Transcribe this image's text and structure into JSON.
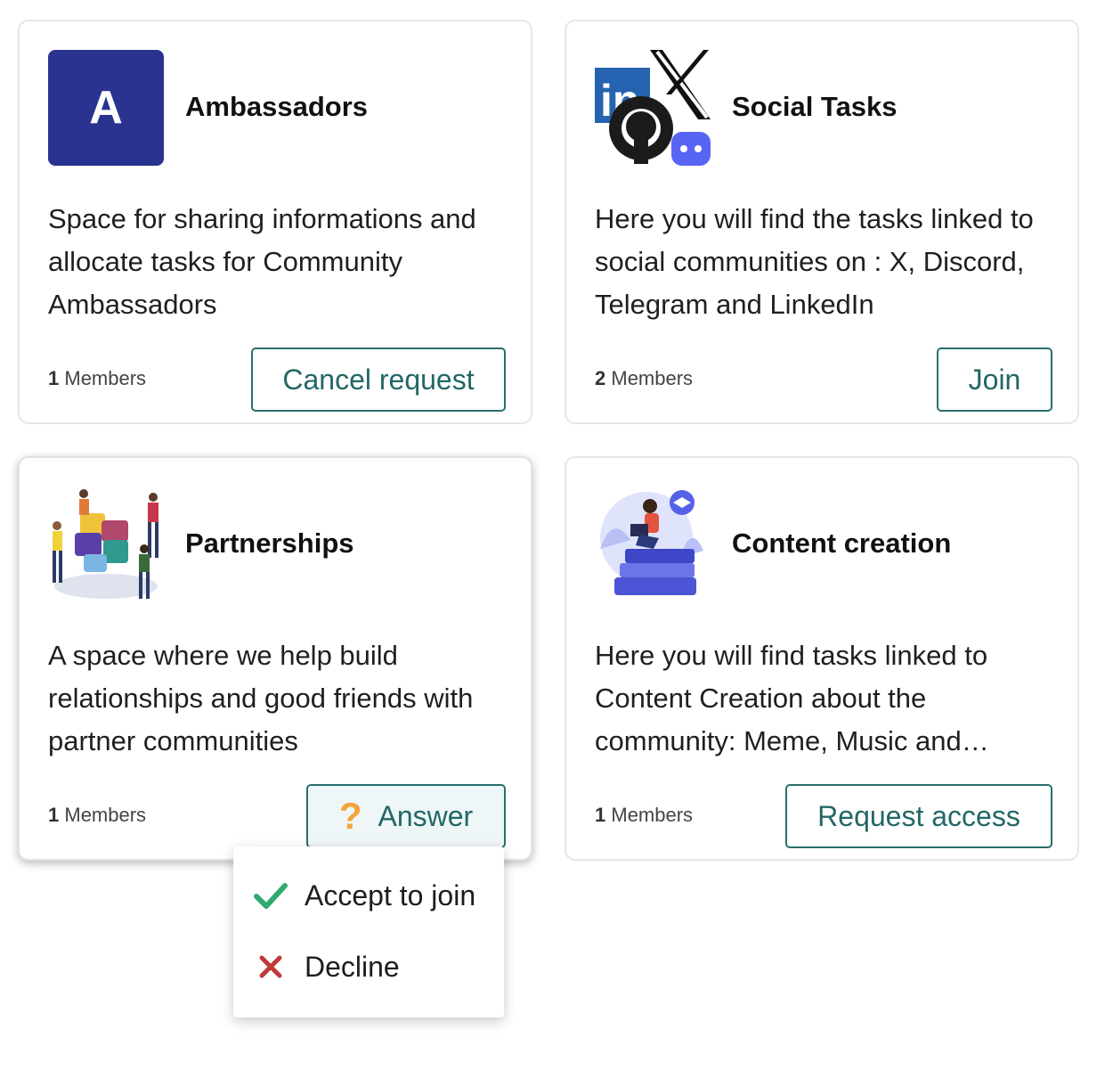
{
  "cards": [
    {
      "title": "Ambassadors",
      "avatar_letter": "A",
      "description": "Space for sharing informations and allocate tasks for Community Ambassadors",
      "members_count": "1",
      "members_label": "Members",
      "button_label": "Cancel request",
      "accent": "#2a3490"
    },
    {
      "title": "Social Tasks",
      "icon_name": "social-logos-icon",
      "description": "Here you will find the tasks linked to social communities on : X, Discord, Telegram and LinkedIn",
      "members_count": "2",
      "members_label": "Members",
      "button_label": "Join"
    },
    {
      "title": "Partnerships",
      "icon_name": "puzzle-people-illustration",
      "description": "A space where we help build relationships and good friends with partner communities",
      "members_count": "1",
      "members_label": "Members",
      "button_label": "Answer",
      "button_icon": "question-icon"
    },
    {
      "title": "Content creation",
      "icon_name": "reading-person-illustration",
      "description": "Here you will find tasks linked to Content Creation about the community: Meme, Music and…",
      "members_count": "1",
      "members_label": "Members",
      "button_label": "Request access"
    }
  ],
  "answer_menu": {
    "items": [
      {
        "label": "Accept to join",
        "icon": "check-icon",
        "color": "#2eaa6e"
      },
      {
        "label": "Decline",
        "icon": "close-icon",
        "color": "#c0393b"
      }
    ]
  },
  "colors": {
    "button_border": "#2a6e6e",
    "button_text": "#236767",
    "question_mark": "#f2a33a"
  }
}
